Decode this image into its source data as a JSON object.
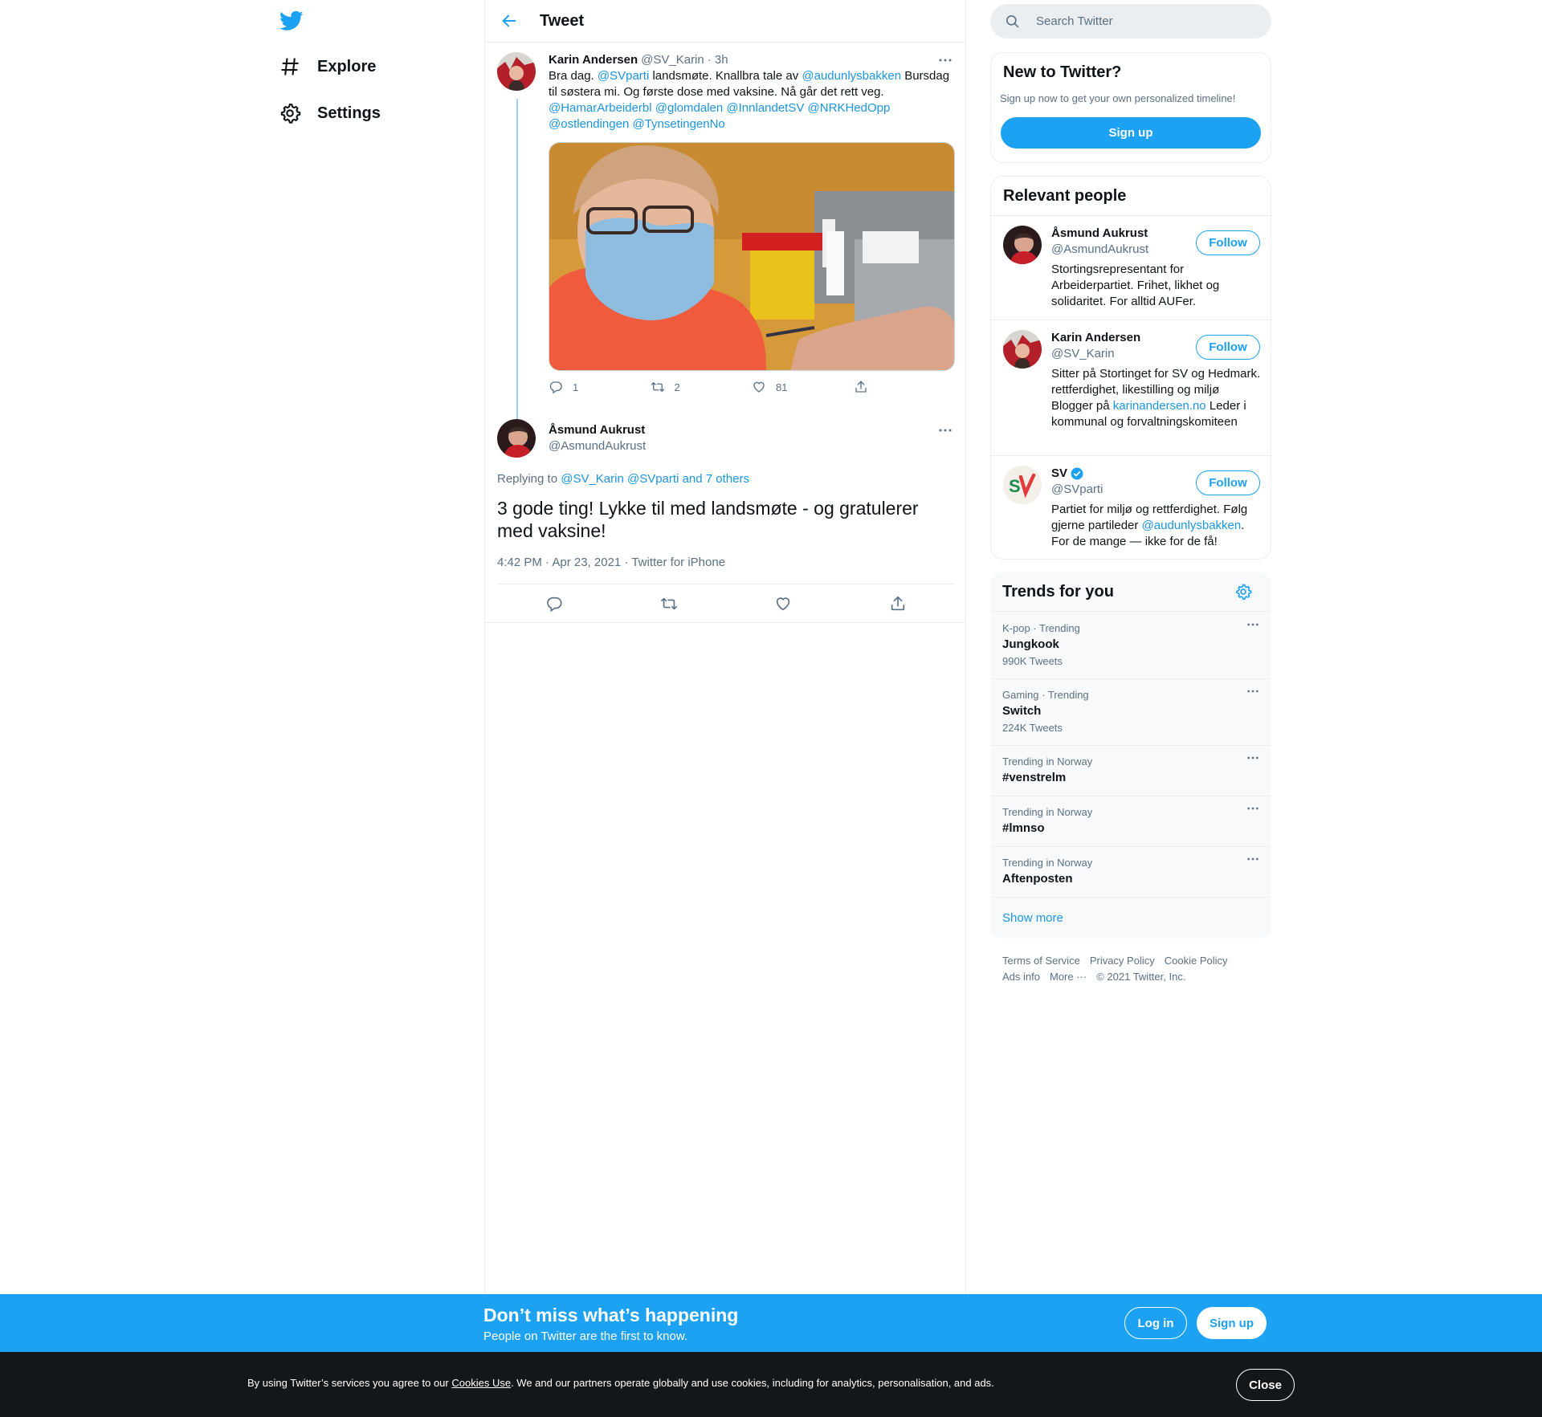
{
  "nav": {
    "explore": "Explore",
    "settings": "Settings"
  },
  "header": {
    "title": "Tweet"
  },
  "tweet1": {
    "name": "Karin Andersen",
    "handle": "@SV_Karin",
    "time": "· 3h",
    "text": [
      {
        "t": "Bra dag. ",
        "link": false
      },
      {
        "t": "@SVparti",
        "link": true
      },
      {
        "t": " landsmøte. Knallbra tale av ",
        "link": false
      },
      {
        "t": "@audunlysbakken",
        "link": true
      },
      {
        "t": " Bursdag til søstera mi. Og første dose med vaksine. Nå går det rett veg. ",
        "link": false
      },
      {
        "t": "@HamarArbeiderbl",
        "link": true
      },
      {
        "t": " ",
        "link": false
      },
      {
        "t": "@glomdalen",
        "link": true
      },
      {
        "t": " ",
        "link": false
      },
      {
        "t": "@InnlandetSV",
        "link": true
      },
      {
        "t": " ",
        "link": false
      },
      {
        "t": "@NRKHedOpp",
        "link": true
      },
      {
        "t": " ",
        "link": false
      },
      {
        "t": "@ostlendingen",
        "link": true
      },
      {
        "t": " ",
        "link": false
      },
      {
        "t": "@TynsetingenNo",
        "link": true
      }
    ],
    "replies": "1",
    "retweets": "2",
    "likes": "81"
  },
  "tweet2": {
    "name": "Åsmund Aukrust",
    "handle": "@AsmundAukrust",
    "replying_prefix": "Replying to ",
    "replying_to": "@SV_Karin @SVparti and 7 others",
    "text": "3 gode ting! Lykke til med landsmøte - og gratulerer med vaksine!",
    "meta": "4:42 PM · Apr 23, 2021 · Twitter for iPhone"
  },
  "search": {
    "placeholder": "Search Twitter"
  },
  "new_to_twitter": {
    "title": "New to Twitter?",
    "sub": "Sign up now to get your own personalized timeline!",
    "button": "Sign up"
  },
  "relevant": {
    "title": "Relevant people",
    "follow_label": "Follow",
    "people": [
      {
        "name": "Åsmund Aukrust",
        "handle": "@AsmundAukrust",
        "bio": [
          {
            "t": "Stortingsrepresentant for Arbeiderpartiet. Frihet, likhet og solidaritet. For alltid AUFer.",
            "link": false
          }
        ]
      },
      {
        "name": "Karin Andersen",
        "handle": "@SV_Karin",
        "bio": [
          {
            "t": "Sitter på Stortinget for SV og Hedmark. rettferdighet, likestilling og miljø Blogger på ",
            "link": false
          },
          {
            "t": "karinandersen.no",
            "link": true
          },
          {
            "t": " Leder i kommunal og forvaltningskomiteen",
            "link": false
          }
        ]
      },
      {
        "name": "SV",
        "handle": "@SVparti",
        "bio": [
          {
            "t": "Partiet for miljø og rettferdighet. Følg gjerne partileder ",
            "link": false
          },
          {
            "t": "@audunlysbakken",
            "link": true
          },
          {
            "t": ". For de mange — ikke for de få!",
            "link": false
          }
        ]
      }
    ]
  },
  "trends": {
    "title": "Trends for you",
    "items": [
      {
        "meta": "K-pop · Trending",
        "name": "Jungkook",
        "count": "990K Tweets"
      },
      {
        "meta": "Gaming · Trending",
        "name": "Switch",
        "count": "224K Tweets"
      },
      {
        "meta": "Trending in Norway",
        "name": "#venstrelm",
        "count": ""
      },
      {
        "meta": "Trending in Norway",
        "name": "#lmnso",
        "count": ""
      },
      {
        "meta": "Trending in Norway",
        "name": "Aftenposten",
        "count": ""
      }
    ],
    "show_more": "Show more"
  },
  "footer": {
    "terms": "Terms of Service",
    "privacy": "Privacy Policy",
    "cookie": "Cookie Policy",
    "ads": "Ads info",
    "more": "More ···",
    "copyright": "© 2021 Twitter, Inc."
  },
  "bottom_bar": {
    "title": "Don’t miss what’s happening",
    "sub": "People on Twitter are the first to know.",
    "login": "Log in",
    "signup": "Sign up"
  },
  "cookie_bar": {
    "prefix": "By using Twitter’s services you agree to our ",
    "link": "Cookies Use",
    "suffix": ". We and our partners operate globally and use cookies, including for analytics, personalisation, and ads.",
    "close": "Close"
  },
  "colors": {
    "accent": "#1da1f2",
    "link": "#1b95e0",
    "secondary_text": "#5b7083",
    "dark_bar": "#14171a"
  },
  "icons": [
    "twitter-logo-icon",
    "hashtag-icon",
    "gear-icon",
    "back-arrow-icon",
    "more-dots-icon",
    "reply-icon",
    "retweet-icon",
    "like-icon",
    "share-icon",
    "search-icon",
    "verified-badge-icon"
  ]
}
